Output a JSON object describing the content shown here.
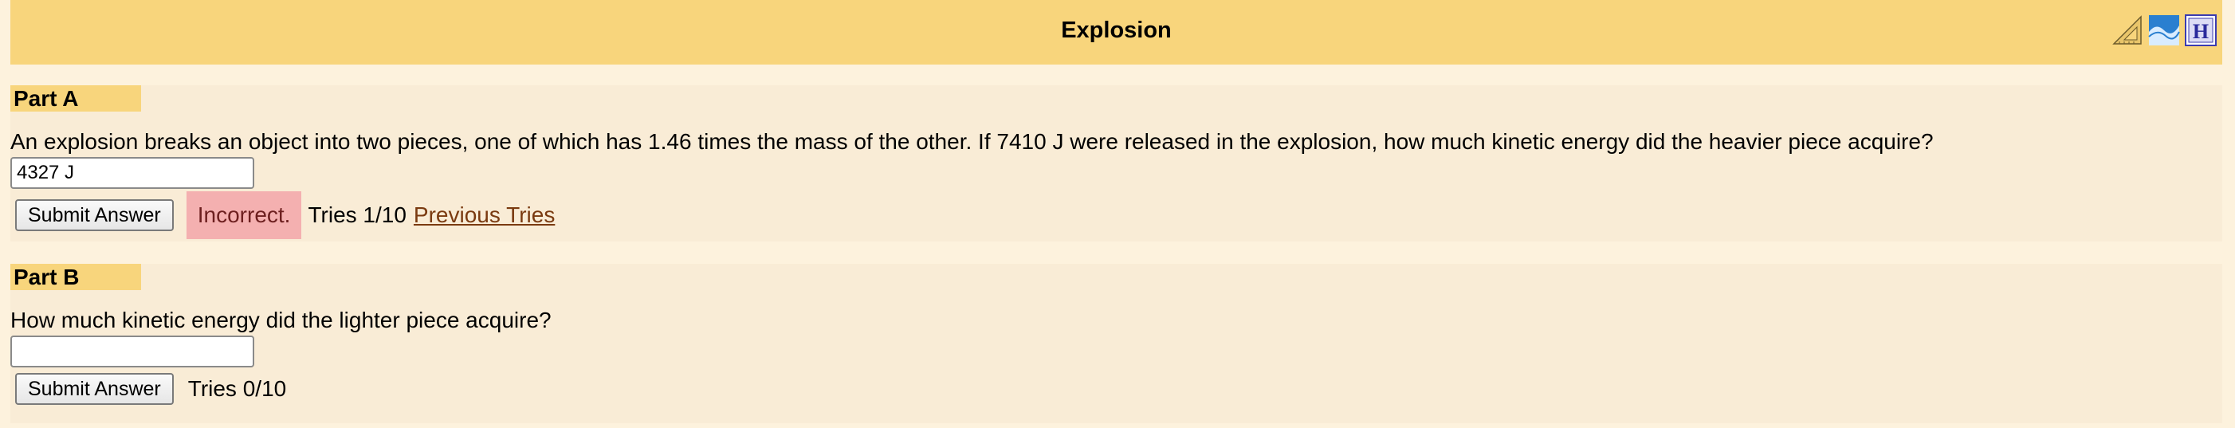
{
  "header": {
    "title": "Explosion",
    "icons": [
      "ruler-triangle-icon",
      "bookmark-wave-icon",
      "help-h-icon"
    ],
    "background_color": "#f8d57c"
  },
  "part_a": {
    "label": "Part A",
    "question": "An explosion breaks an object into two pieces, one of which has 1.46 times the mass of the other. If 7410 J were released in the explosion, how much kinetic energy did the heavier piece acquire?",
    "answer_value": "4327 J",
    "submit_label": "Submit Answer",
    "feedback": "Incorrect.",
    "feedback_color": "#f4b0b0",
    "tries": "Tries 1/10",
    "previous_tries_link": "Previous Tries"
  },
  "part_b": {
    "label": "Part B",
    "question": "How much kinetic energy did the lighter piece acquire?",
    "answer_value": "",
    "submit_label": "Submit Answer",
    "tries": "Tries 0/10"
  }
}
